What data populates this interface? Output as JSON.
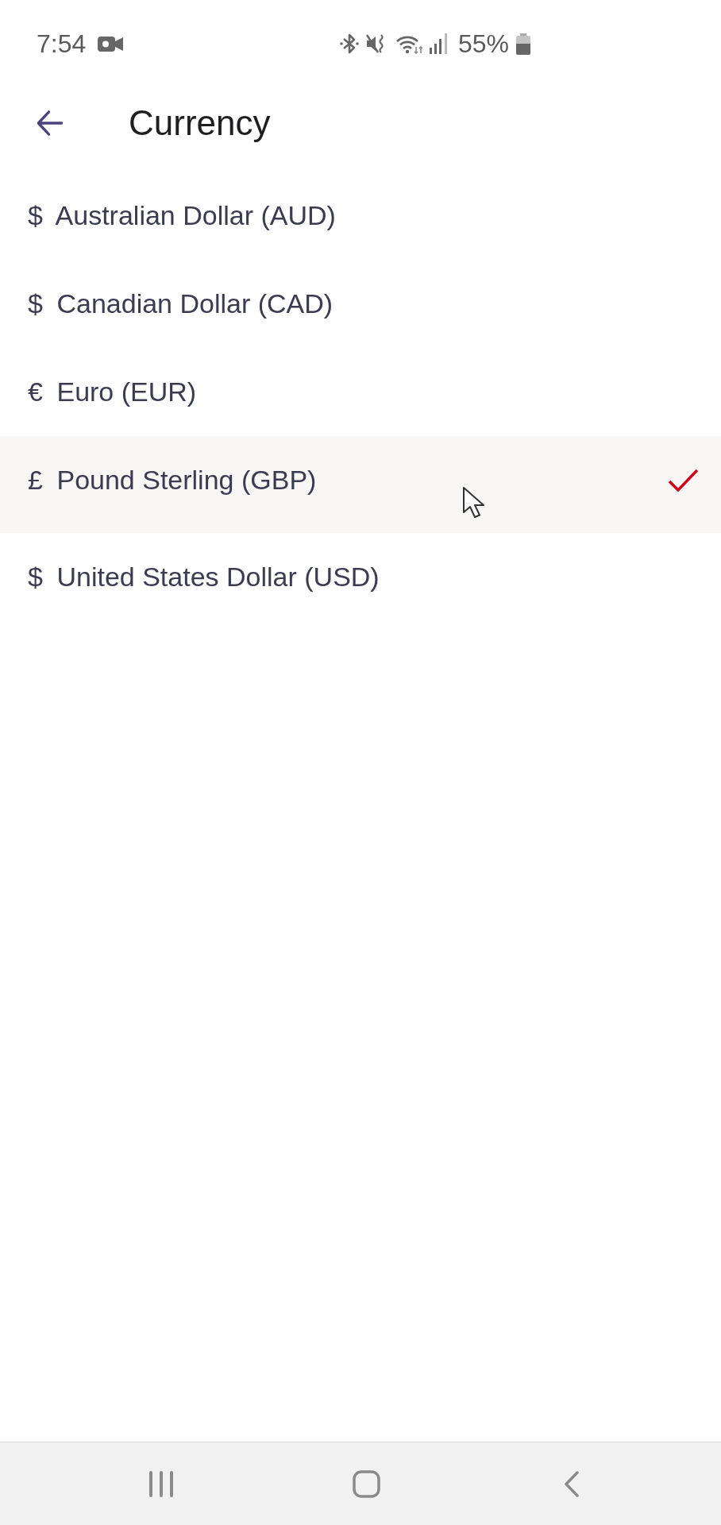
{
  "status_bar": {
    "time": "7:54",
    "battery_text": "55%"
  },
  "header": {
    "title": "Currency"
  },
  "currencies": [
    {
      "symbol": "$",
      "name": "Australian Dollar (AUD)",
      "selected": false
    },
    {
      "symbol": "$",
      "name": "Canadian Dollar (CAD)",
      "selected": false
    },
    {
      "symbol": "€",
      "name": "Euro (EUR)",
      "selected": false
    },
    {
      "symbol": "£",
      "name": "Pound Sterling (GBP)",
      "selected": true
    },
    {
      "symbol": "$",
      "name": "United States Dollar (USD)",
      "selected": false
    }
  ]
}
